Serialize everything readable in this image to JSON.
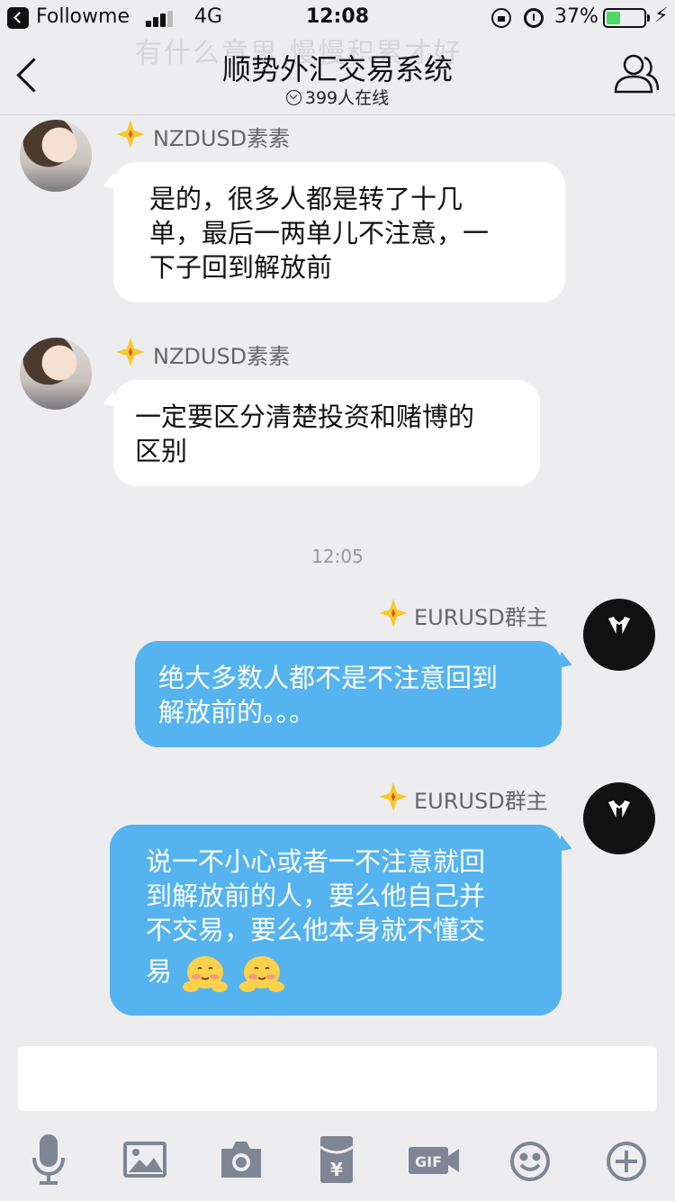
{
  "status_bar": {
    "app_name": "Followme",
    "network": "4G",
    "time": "12:08",
    "battery_pct": "37%",
    "battery_level": 0.37,
    "signal_bars": 3
  },
  "header": {
    "ghost_text": "有什么意思    慢慢积累才好",
    "title": "顺势外汇交易系统",
    "online": "399人在线",
    "icons": [
      "back-icon",
      "group-members-icon"
    ]
  },
  "messages": [
    {
      "sender": "NZDUSD素素",
      "side": "in",
      "avatar": "girl-avatar",
      "lines": [
        "是的，很多人都是转了十几",
        "单，最后一两单儿不注意，一",
        "下子回到解放前"
      ]
    },
    {
      "sender": "NZDUSD素素",
      "side": "in",
      "avatar": "girl-avatar",
      "lines": [
        "一定要区分清楚投资和赌博的",
        "区别"
      ]
    },
    {
      "timestamp": "12:05"
    },
    {
      "sender": "EURUSD群主",
      "side": "out",
      "avatar": "suit-avatar",
      "lines": [
        "绝大多数人都不是不注意回到",
        "解放前的。。。"
      ]
    },
    {
      "sender": "EURUSD群主",
      "side": "out",
      "avatar": "suit-avatar",
      "lines": [
        "说一不小心或者一不注意就回",
        "到解放前的人，要么他自己并",
        "不交易，要么他本身就不懂交",
        "易"
      ],
      "emojis": [
        "blush-emoji",
        "blush-emoji"
      ]
    }
  ],
  "toolbar": [
    "microphone-icon",
    "image-icon",
    "camera-icon",
    "red-envelope-icon",
    "gif-icon",
    "emoji-icon",
    "plus-icon"
  ],
  "colors": {
    "outgoing_bubble": "#55b3ef",
    "incoming_bubble": "#ffffff",
    "background": "#ededf0"
  }
}
